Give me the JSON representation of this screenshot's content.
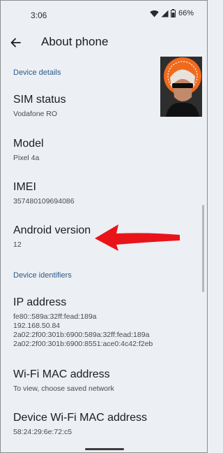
{
  "status_bar": {
    "time": "3:06",
    "battery": "66%"
  },
  "header": {
    "title": "About phone"
  },
  "sections": [
    {
      "header": "Device details"
    },
    {
      "header": "Device identifiers"
    }
  ],
  "items": [
    {
      "title": "SIM status",
      "summary": "Vodafone RO"
    },
    {
      "title": "Model",
      "summary": "Pixel 4a"
    },
    {
      "title": "IMEI",
      "summary": "357480109694086"
    },
    {
      "title": "Android version",
      "summary": "12"
    },
    {
      "title": "IP address",
      "summary": "fe80::589a:32ff:fead:189a\n192.168.50.84\n2a02:2f00:301b:6900:589a:32ff:fead:189a\n2a02:2f00:301b:6900:8551:ace0:4c42:f2eb"
    },
    {
      "title": "Wi-Fi MAC address",
      "summary": "To view, choose saved network"
    },
    {
      "title": "Device Wi-Fi MAC address",
      "summary": "58:24:29:6e:72:c5"
    }
  ],
  "annotation": {
    "arrow_color": "#e8141a"
  }
}
